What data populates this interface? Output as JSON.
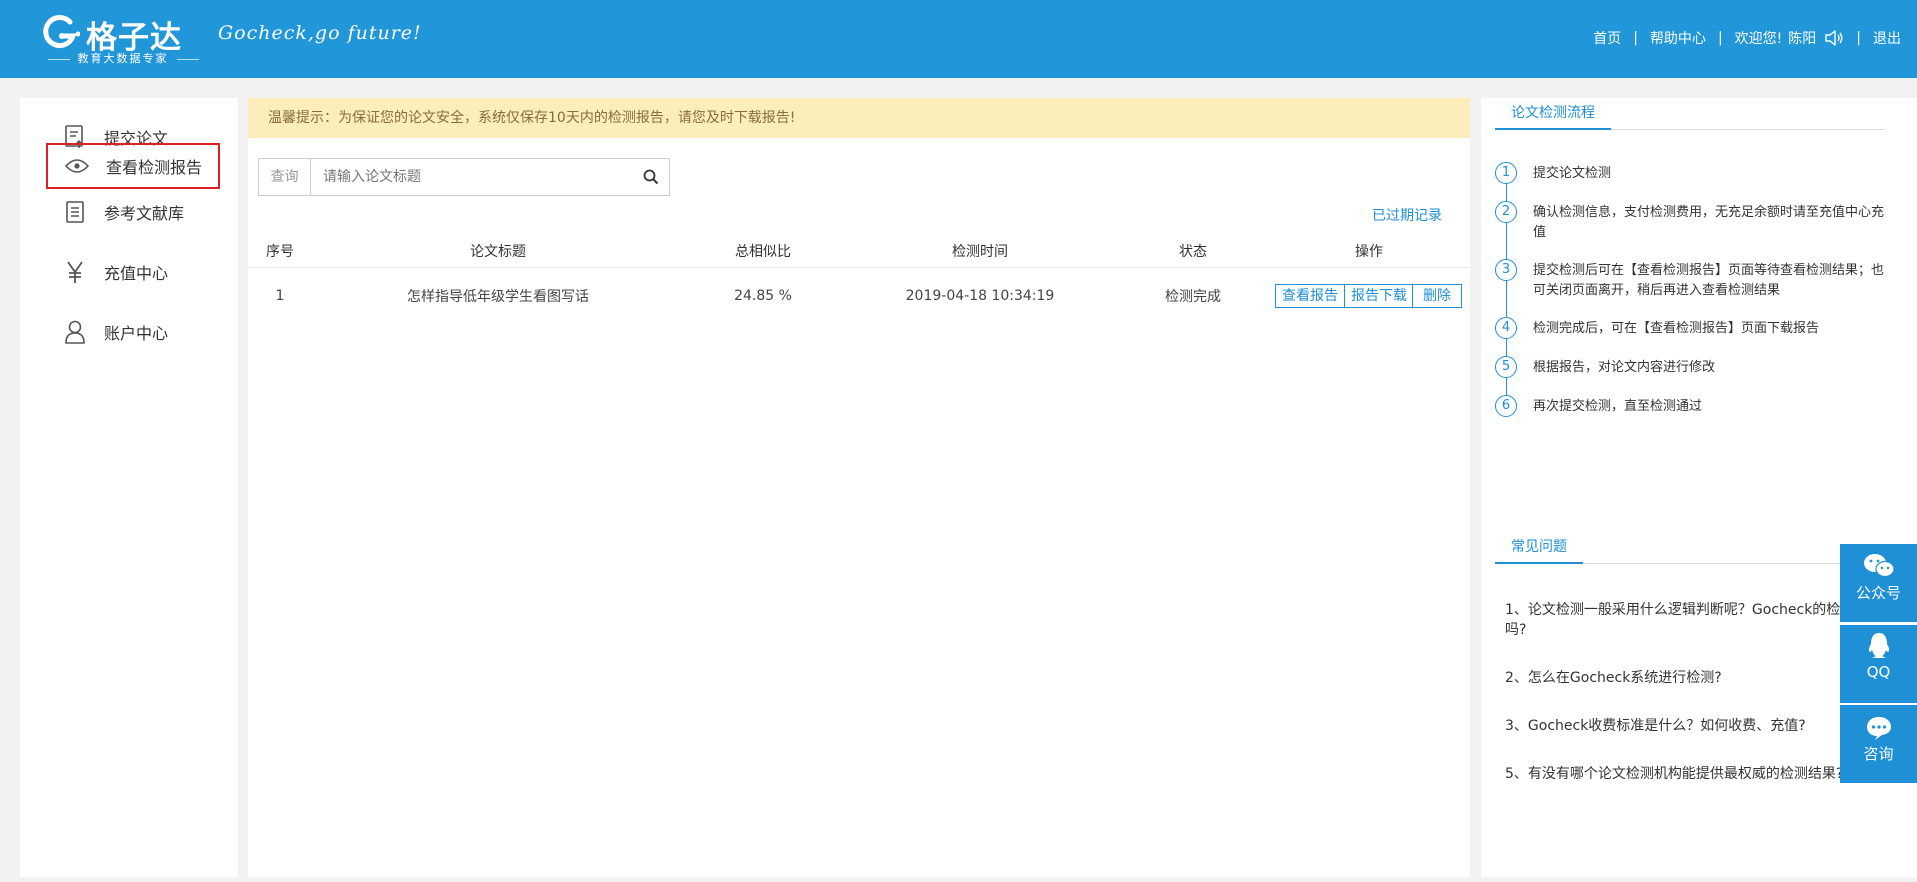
{
  "header": {
    "logo_name": "格子达",
    "logo_sub": "教育大数据专家",
    "slogan": "Gocheck,go future!",
    "nav": {
      "home": "首页",
      "help": "帮助中心",
      "welcome": "欢迎您!",
      "user": "陈阳",
      "logout": "退出",
      "separator": "|"
    }
  },
  "sidebar": {
    "items": [
      {
        "label": "提交论文",
        "icon": "upload-document-icon"
      },
      {
        "label": "查看检测报告",
        "icon": "eye-icon",
        "active": true
      },
      {
        "label": "参考文献库",
        "icon": "list-document-icon"
      },
      {
        "label": "充值中心",
        "icon": "yen-icon"
      },
      {
        "label": "账户中心",
        "icon": "user-icon"
      }
    ]
  },
  "main": {
    "notice": "温馨提示：为保证您的论文安全，系统仅保存10天内的检测报告，请您及时下载报告!",
    "search": {
      "tag": "查询",
      "placeholder": "请输入论文标题"
    },
    "expired_link": "已过期记录",
    "table": {
      "headers": [
        "序号",
        "论文标题",
        "总相似比",
        "检测时间",
        "状态",
        "操作"
      ],
      "rows": [
        {
          "index": "1",
          "title": "怎样指导低年级学生看图写话",
          "similarity": "24.85 %",
          "time": "2019-04-18 10:34:19",
          "status": "检测完成",
          "actions": [
            "查看报告",
            "报告下载",
            "删除"
          ]
        }
      ]
    }
  },
  "right": {
    "process_title": "论文检测流程",
    "steps": [
      {
        "num": "1",
        "text": "提交论文检测"
      },
      {
        "num": "2",
        "text": "确认检测信息，支付检测费用，无充足余额时请至充值中心充值"
      },
      {
        "num": "3",
        "text": "提交检测后可在【查看检测报告】页面等待查看检测结果；也可关闭页面离开，稍后再进入查看检测结果"
      },
      {
        "num": "4",
        "text": "检测完成后，可在【查看检测报告】页面下载报告"
      },
      {
        "num": "5",
        "text": "根据报告，对论文内容进行修改"
      },
      {
        "num": "6",
        "text": "再次提交检测，直至检测通过"
      }
    ],
    "faq_title": "常见问题",
    "faqs": [
      "1、论文检测一般采用什么逻辑判断呢？Gocheck的检测够准确吗?",
      "2、怎么在Gocheck系统进行检测?",
      "3、Gocheck收费标准是什么？如何收费、充值?",
      "5、有没有哪个论文检测机构能提供最权威的检测结果?"
    ]
  },
  "floating": [
    {
      "label": "公众号",
      "icon": "wechat-icon"
    },
    {
      "label": "QQ",
      "icon": "qq-icon"
    },
    {
      "label": "咨询",
      "icon": "chat-bubble-icon"
    }
  ],
  "colors": {
    "header_bg": "#2196d8",
    "accent": "#1f8fd6",
    "notice_bg": "#fbedbc",
    "active_border": "#e02020"
  }
}
